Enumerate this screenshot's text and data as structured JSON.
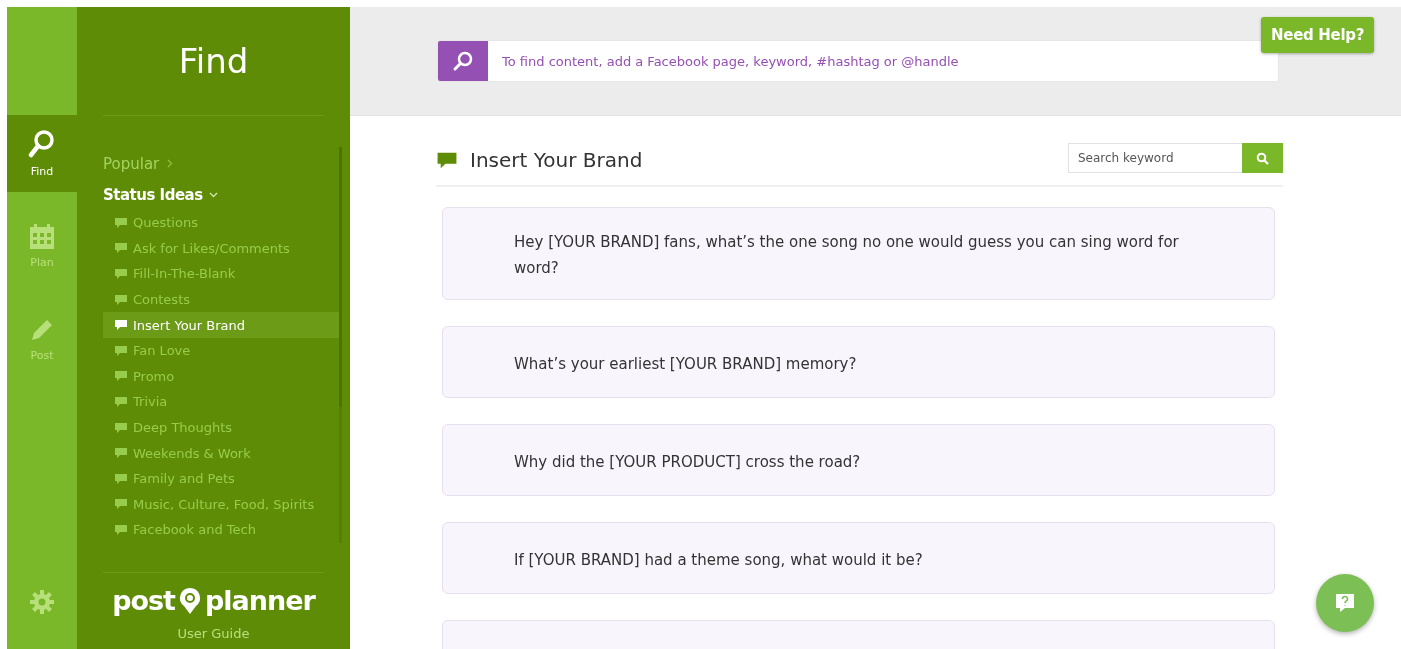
{
  "rail": {
    "items": [
      {
        "kind": "find",
        "label": "Find",
        "selected": true
      },
      {
        "kind": "plan",
        "label": "Plan",
        "selected": false
      },
      {
        "kind": "post",
        "label": "Post",
        "selected": false
      }
    ]
  },
  "panel": {
    "title": "Find",
    "menu": [
      {
        "label": "Popular",
        "expanded": false
      },
      {
        "label": "Status Ideas",
        "expanded": true,
        "children": [
          {
            "label": "Questions",
            "selected": false
          },
          {
            "label": "Ask for Likes/Comments",
            "selected": false
          },
          {
            "label": "Fill-In-The-Blank",
            "selected": false
          },
          {
            "label": "Contests",
            "selected": false
          },
          {
            "label": "Insert Your Brand",
            "selected": true
          },
          {
            "label": "Fan Love",
            "selected": false
          },
          {
            "label": "Promo",
            "selected": false
          },
          {
            "label": "Trivia",
            "selected": false
          },
          {
            "label": "Deep Thoughts",
            "selected": false
          },
          {
            "label": "Weekends & Work",
            "selected": false
          },
          {
            "label": "Family and Pets",
            "selected": false
          },
          {
            "label": "Music, Culture, Food, Spirits",
            "selected": false
          },
          {
            "label": "Facebook and Tech",
            "selected": false
          }
        ]
      }
    ],
    "logo": {
      "left": "post",
      "right": "planner"
    },
    "user_guide": "User Guide"
  },
  "search": {
    "placeholder": "To find content, add a Facebook page, keyword, #hashtag or @handle"
  },
  "help_button": "Need Help?",
  "section": {
    "title": "Insert Your Brand",
    "keyword_search": {
      "placeholder": "Search keyword"
    }
  },
  "cards": [
    {
      "text": "Hey [YOUR BRAND] fans, what’s the one song no one would guess you can sing word for word?"
    },
    {
      "text": "What’s your earliest [YOUR BRAND] memory?"
    },
    {
      "text": "Why did the [YOUR PRODUCT] cross the road?"
    },
    {
      "text": "If [YOUR BRAND] had a theme song, what would it be?"
    },
    {
      "kind": "partial"
    }
  ]
}
